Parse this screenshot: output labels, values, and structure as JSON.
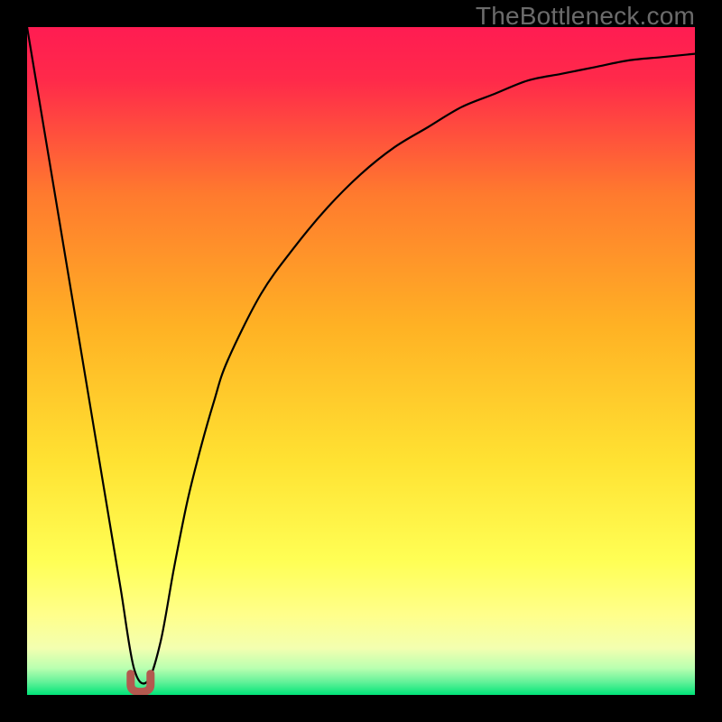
{
  "watermark": "TheBottleneck.com",
  "colors": {
    "frame": "#000000",
    "curve": "#000000",
    "marker": "#b3594f",
    "gradient_top": "#ff1c52",
    "gradient_mid": "#ffe232",
    "gradient_yellowband": "#ffff8b",
    "gradient_bottom": "#00e478"
  },
  "chart_data": {
    "type": "line",
    "title": "",
    "xlabel": "",
    "ylabel": "",
    "xlim": [
      0,
      100
    ],
    "ylim": [
      0,
      100
    ],
    "x": [
      0,
      2,
      4,
      6,
      8,
      10,
      12,
      14,
      16,
      18,
      20,
      22,
      24,
      26,
      28,
      30,
      35,
      40,
      45,
      50,
      55,
      60,
      65,
      70,
      75,
      80,
      85,
      90,
      95,
      100
    ],
    "series": [
      {
        "name": "bottleneck-curve",
        "values": [
          100,
          88,
          76,
          64,
          52,
          40,
          28,
          16,
          4,
          2,
          8,
          19,
          29,
          37,
          44,
          50,
          60,
          67,
          73,
          78,
          82,
          85,
          88,
          90,
          92,
          93,
          94,
          95,
          95.5,
          96
        ]
      }
    ],
    "marker": {
      "x": 17,
      "y": 1
    }
  }
}
